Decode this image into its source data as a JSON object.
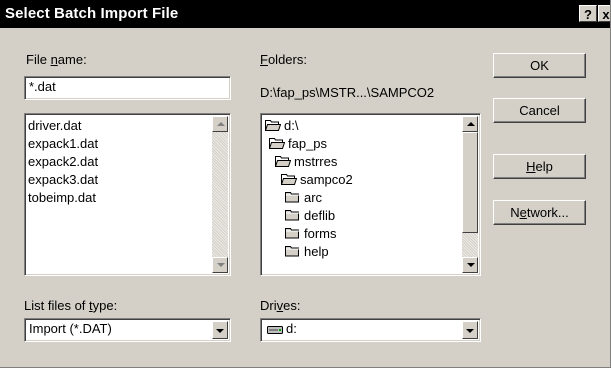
{
  "window": {
    "title": "Select Batch Import File",
    "help_glyph": "?",
    "close_glyph": "x"
  },
  "file_name": {
    "label_pre": "File ",
    "label_key": "n",
    "label_post": "ame:",
    "value": "*.dat",
    "files": [
      "driver.dat",
      "expack1.dat",
      "expack2.dat",
      "expack3.dat",
      "tobeimp.dat"
    ]
  },
  "folders": {
    "label_key": "F",
    "label_post": "olders:",
    "path": "D:\\fap_ps\\MSTR...\\SAMPCO2",
    "items": [
      {
        "name": "d:\\",
        "icon": "open-folder-icon"
      },
      {
        "name": "fap_ps",
        "icon": "open-folder-icon"
      },
      {
        "name": "mstrres",
        "icon": "open-folder-icon"
      },
      {
        "name": "sampco2",
        "icon": "open-folder-icon"
      },
      {
        "name": "arc",
        "icon": "folder-icon"
      },
      {
        "name": "deflib",
        "icon": "folder-icon"
      },
      {
        "name": "forms",
        "icon": "folder-icon"
      },
      {
        "name": "help",
        "icon": "folder-icon"
      }
    ]
  },
  "file_type": {
    "label_pre": "List files of ",
    "label_key": "t",
    "label_post": "ype:",
    "value": "Import (*.DAT)"
  },
  "drives": {
    "label_pre": "Dri",
    "label_key": "v",
    "label_post": "es:",
    "value": "d:"
  },
  "buttons": {
    "ok": "OK",
    "cancel": "Cancel",
    "help_key": "H",
    "help_rest": "elp",
    "network_pre": "N",
    "network_key": "e",
    "network_rest": "twork..."
  }
}
